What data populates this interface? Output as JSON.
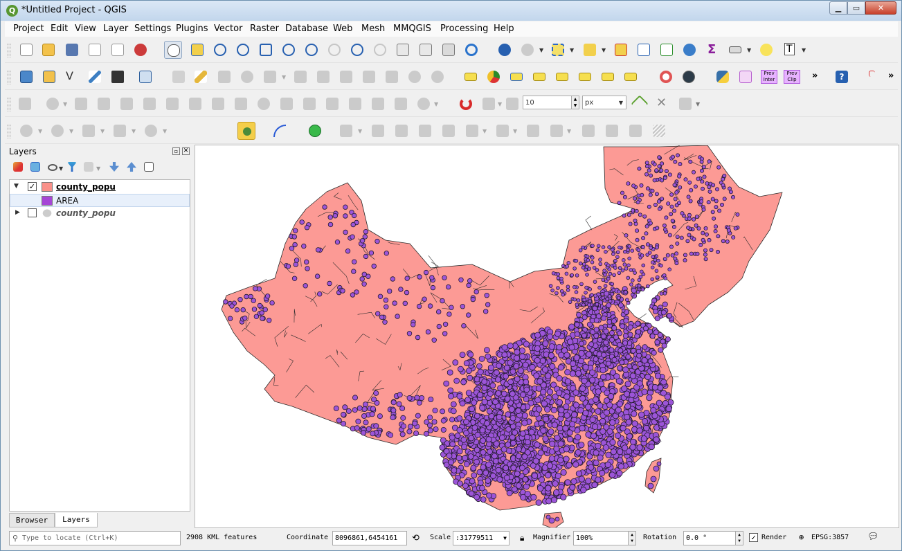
{
  "window": {
    "title": "*Untitled Project - QGIS",
    "logo": "Q"
  },
  "menubar": [
    "Project",
    "Edit",
    "View",
    "Layer",
    "Settings",
    "Plugins",
    "Vector",
    "Raster",
    "Database",
    "Web",
    "Mesh",
    "MMQGIS",
    "Processing",
    "Help"
  ],
  "toolbars": {
    "digitize": {
      "snap_tolerance": "10",
      "snap_units": "px"
    },
    "preview_labels": {
      "prev_inter": "Prev Inter",
      "prev_clip": "Prev Clip"
    },
    "more": "»"
  },
  "layers_panel": {
    "title": "Layers",
    "items": [
      {
        "name": "county_popu",
        "checked": true,
        "swatch": "#f9918a",
        "bold": true
      },
      {
        "name": "AREA",
        "swatch": "#a646d6",
        "legend": true
      },
      {
        "name": "county_popu",
        "checked": false,
        "italic": true
      }
    ],
    "tabs": [
      "Browser",
      "Layers"
    ],
    "active_tab": "Layers"
  },
  "map": {
    "fill_color": "#fc9a95",
    "point_color": "#9c55d8",
    "outline": "#2b2b2b"
  },
  "statusbar": {
    "locate_placeholder": "Type to locate (Ctrl+K)",
    "feature_count": "2908 KML features",
    "coordinate_label": "Coordinate",
    "coordinate_value": "8096861,6454161",
    "scale_label": "Scale",
    "scale_value": ":31779511",
    "magnifier_label": "Magnifier",
    "magnifier_value": "100%",
    "rotation_label": "Rotation",
    "rotation_value": "0.0 °",
    "render_label": "Render",
    "render_checked": true,
    "crs": "EPSG:3857"
  }
}
